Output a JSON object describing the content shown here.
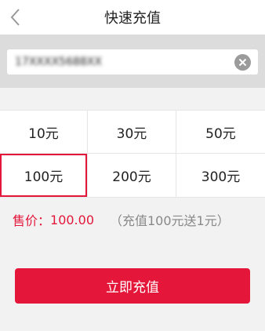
{
  "header": {
    "title": "快速充值",
    "back_icon": "chevron-left-icon"
  },
  "phone": {
    "value": "17XXXX5688XX",
    "clear_icon": "clear-circle-icon"
  },
  "amounts": [
    {
      "label": "10元",
      "selected": false
    },
    {
      "label": "30元",
      "selected": false
    },
    {
      "label": "50元",
      "selected": false
    },
    {
      "label": "100元",
      "selected": true
    },
    {
      "label": "200元",
      "selected": false
    },
    {
      "label": "300元",
      "selected": false
    }
  ],
  "price": {
    "label": "售价：",
    "value": "100.00",
    "note": "（充值100元送1元）"
  },
  "confirm": {
    "label": "立即充值"
  },
  "colors": {
    "accent": "#e4163a",
    "muted": "#888888"
  }
}
